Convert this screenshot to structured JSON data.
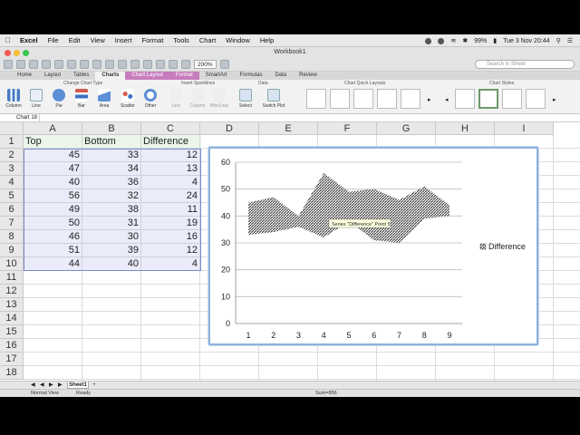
{
  "menubar": {
    "apple": "",
    "app_name": "Excel",
    "items": [
      "File",
      "Edit",
      "View",
      "Insert",
      "Format",
      "Tools",
      "Chart",
      "Window",
      "Help"
    ],
    "battery": "99%",
    "clock": "Tue 3 Nov  20:44"
  },
  "window": {
    "title": "Workbook1"
  },
  "toolbar": {
    "zoom": "200%",
    "search_placeholder": "Search in Sheet"
  },
  "ribbon": {
    "tabs": [
      "Home",
      "Layout",
      "Tables",
      "Charts",
      "Chart Layout",
      "Format",
      "SmartArt",
      "Formulas",
      "Data",
      "Review"
    ],
    "active_tab": "Charts",
    "groups": [
      "Change Chart Type",
      "Insert Sparklines",
      "Data",
      "Chart Quick Layouts",
      "Chart Styles"
    ],
    "buttons": [
      "Column",
      "Line",
      "Pie",
      "Bar",
      "Area",
      "Scatter",
      "Other",
      "Line",
      "Column",
      "Win/Loss",
      "Select",
      "Switch Plot"
    ]
  },
  "namebox": "Chart 18",
  "grid": {
    "columns": [
      "A",
      "B",
      "C",
      "D",
      "E",
      "F",
      "G",
      "H",
      "I"
    ],
    "rows": [
      "1",
      "2",
      "3",
      "4",
      "5",
      "6",
      "7",
      "8",
      "9",
      "10",
      "11",
      "12",
      "13",
      "14",
      "15",
      "16",
      "17",
      "18"
    ],
    "headers": [
      "Top",
      "Bottom",
      "Difference"
    ],
    "data": [
      [
        "45",
        "33",
        "12"
      ],
      [
        "47",
        "34",
        "13"
      ],
      [
        "40",
        "36",
        "4"
      ],
      [
        "56",
        "32",
        "24"
      ],
      [
        "49",
        "38",
        "11"
      ],
      [
        "50",
        "31",
        "19"
      ],
      [
        "46",
        "30",
        "16"
      ],
      [
        "51",
        "39",
        "12"
      ],
      [
        "44",
        "40",
        "4"
      ]
    ]
  },
  "chart_data": {
    "type": "area",
    "x": [
      1,
      2,
      3,
      4,
      5,
      6,
      7,
      8,
      9
    ],
    "series": [
      {
        "name": "Difference",
        "base": [
          33,
          34,
          36,
          32,
          38,
          31,
          30,
          39,
          40
        ],
        "values": [
          12,
          13,
          4,
          24,
          11,
          19,
          16,
          12,
          4
        ]
      }
    ],
    "yticks": [
      "0",
      "10",
      "20",
      "30",
      "40",
      "50",
      "60"
    ],
    "xticks": [
      "1",
      "2",
      "3",
      "4",
      "5",
      "6",
      "7",
      "8",
      "9"
    ],
    "ylim": [
      0,
      60
    ],
    "legend": "right",
    "grid": true,
    "tooltip": "Series \"Difference\" Point 5",
    "fill_color": "#444444"
  },
  "sheet": {
    "tab": "Sheet1",
    "add": "+"
  },
  "status": {
    "view": "Normal View",
    "ready": "Ready",
    "sum": "Sum=856"
  }
}
